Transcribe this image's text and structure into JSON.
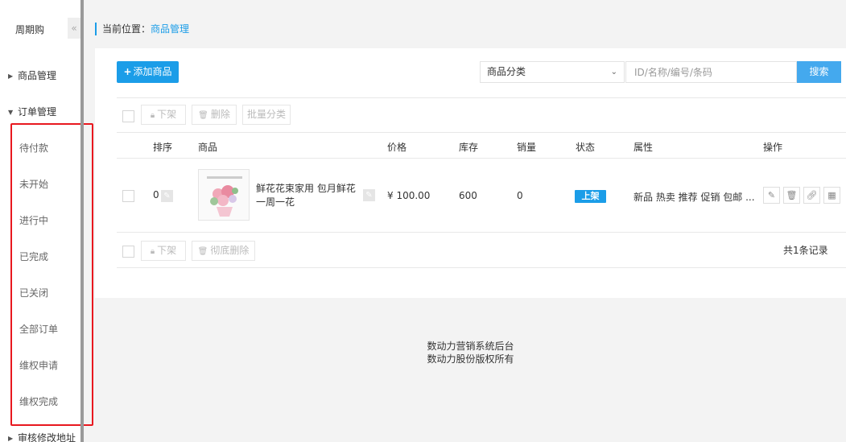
{
  "sidebar": {
    "brand": "周期购",
    "collapse_icon": "«",
    "groups": {
      "products": "商品管理",
      "orders": "订单管理",
      "review_address": "审核修改地址"
    },
    "order_items": [
      "待付款",
      "未开始",
      "进行中",
      "已完成",
      "已关闭",
      "全部订单",
      "维权申请",
      "维权完成"
    ]
  },
  "breadcrumb": {
    "label": "当前位置：",
    "current": "商品管理"
  },
  "toolbar": {
    "add_label": "添加商品",
    "category_select": "商品分类",
    "search_placeholder": "ID/名称/编号/条码",
    "search_label": "搜索"
  },
  "bulk_top": {
    "offshelf": "下架",
    "delete": "删除",
    "batch_category": "批量分类"
  },
  "table": {
    "headers": [
      "排序",
      "商品",
      "价格",
      "库存",
      "销量",
      "状态",
      "属性",
      "操作"
    ],
    "rows": [
      {
        "sort": "0",
        "name": "鲜花花束家用 包月鲜花一周一花",
        "price": "¥ 100.00",
        "stock": "600",
        "sales": "0",
        "status": "上架",
        "attributes": "新品 热卖 推荐 促销 包邮 ..."
      }
    ]
  },
  "bulk_bottom": {
    "offshelf": "下架",
    "delete_permanent": "彻底删除",
    "record_count": "共1条记录"
  },
  "footer": {
    "line1": "数动力营销系统后台",
    "line2": "数动力股份版权所有"
  },
  "colors": {
    "accent": "#1b9de8",
    "highlight_border": "#e8181f"
  }
}
